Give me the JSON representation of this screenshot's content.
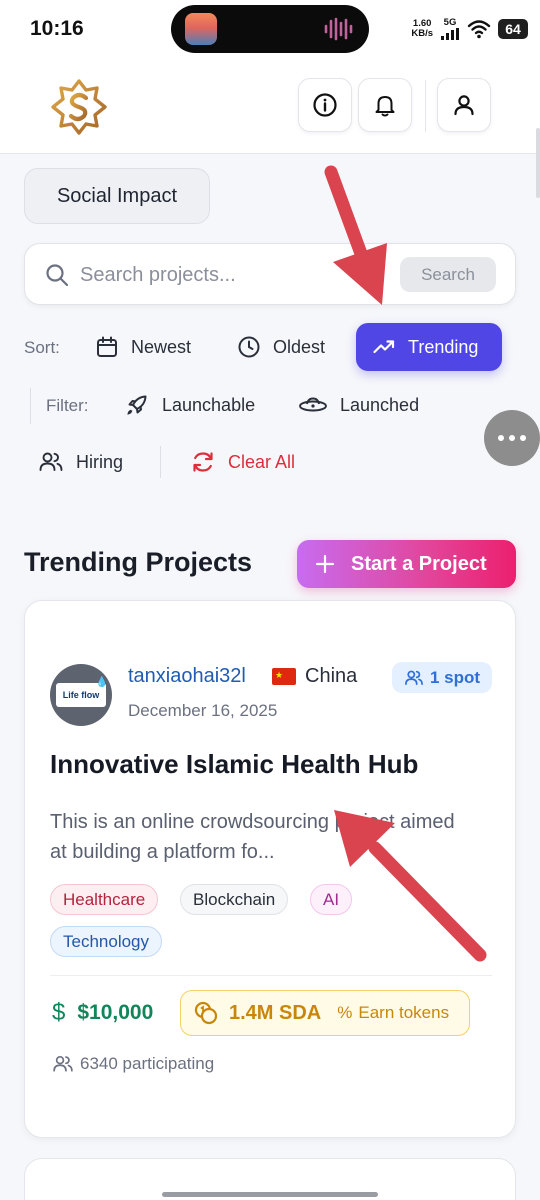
{
  "status_bar": {
    "time": "10:16",
    "net_speed_value": "1.60",
    "net_speed_unit": "KB/s",
    "network": "5G",
    "battery": "64"
  },
  "header": {
    "logo_icon": "s-star-logo-icon",
    "info_icon": "info-icon",
    "bell_icon": "bell-icon",
    "user_icon": "user-icon"
  },
  "category_chip": "Social Impact",
  "search": {
    "placeholder": "Search projects...",
    "button_label": "Search"
  },
  "sort": {
    "label": "Sort:",
    "options": [
      {
        "label": "Newest",
        "icon": "calendar-icon"
      },
      {
        "label": "Oldest",
        "icon": "clock-icon"
      },
      {
        "label": "Trending",
        "icon": "trending-up-icon",
        "active": true
      }
    ]
  },
  "filter": {
    "label": "Filter:",
    "options": [
      {
        "label": "Launchable",
        "icon": "rocket-icon"
      },
      {
        "label": "Launched",
        "icon": "ufo-icon"
      },
      {
        "label": "Hiring",
        "icon": "users-icon"
      }
    ],
    "clear_label": "Clear All"
  },
  "section": {
    "title": "Trending Projects",
    "start_button": "Start a Project"
  },
  "project": {
    "avatar_text": "Life flow",
    "username": "tanxiaohai32l",
    "country": "China",
    "spots": "1 spot",
    "date": "December 16, 2025",
    "title": "Innovative Islamic Health Hub",
    "description": "This is an online crowdsourcing project aimed at building a platform fo...",
    "tags": [
      "Healthcare",
      "Blockchain",
      "AI",
      "Technology"
    ],
    "price": "$10,000",
    "token_amount": "1.4M SDA",
    "earn_label": "Earn tokens",
    "participating": "6340 participating"
  },
  "colors": {
    "accent": "#4f46e5",
    "clear": "#dc2e3b",
    "price": "#11865a",
    "token": "#c8870a",
    "annotation_arrow": "#d9444f"
  }
}
